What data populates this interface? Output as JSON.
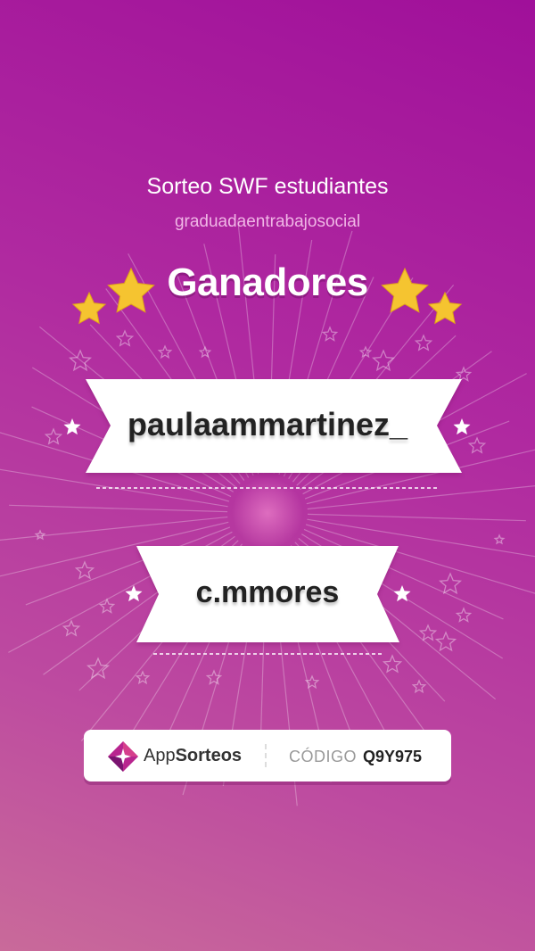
{
  "raffle": {
    "title": "Sorteo SWF estudiantes",
    "account": "graduadaentrabajosocial",
    "heading": "Ganadores"
  },
  "winners": [
    {
      "name": "paulaammartinez_"
    },
    {
      "name": "c.mmores"
    }
  ],
  "footer": {
    "brand_light": "App",
    "brand_bold": "Sorteos",
    "code_label": "CÓDIGO",
    "code_value": "Q9Y975"
  },
  "colors": {
    "background_top": "#a0109a",
    "background_bottom": "#c96a9a",
    "star_gold": "#f5c430",
    "ribbon": "#ffffff"
  },
  "icons": [
    "star-icon",
    "appsorteos-logo-icon"
  ]
}
